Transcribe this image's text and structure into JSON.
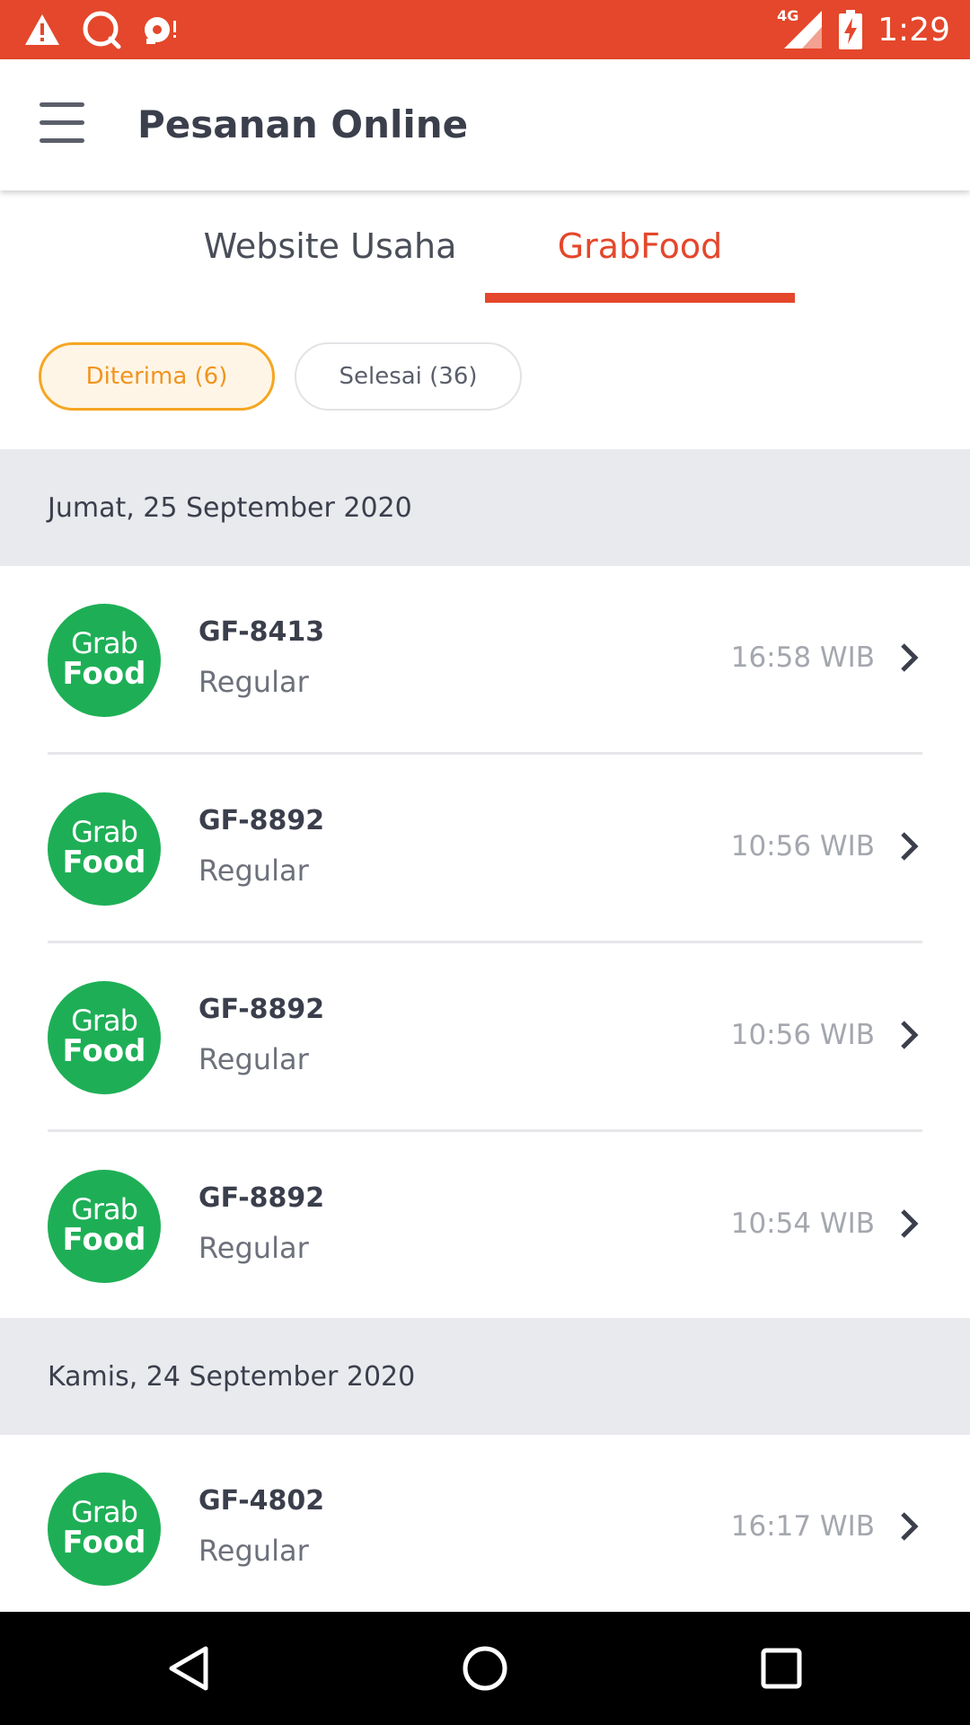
{
  "status_bar": {
    "time": "1:29",
    "network": "4G",
    "icons": [
      "warning-icon",
      "chat-bubble-icon",
      "notification-badge-icon",
      "signal-icon",
      "battery-charging-icon"
    ]
  },
  "app_bar": {
    "title": "Pesanan Online",
    "menu_icon": "hamburger-menu-icon"
  },
  "tabs": [
    {
      "label": "Website Usaha",
      "active": false
    },
    {
      "label": "GrabFood",
      "active": true
    }
  ],
  "filters": [
    {
      "label": "Diterima (6)",
      "active": true
    },
    {
      "label": "Selesai (36)",
      "active": false
    }
  ],
  "groups": [
    {
      "date": "Jumat, 25 September 2020",
      "orders": [
        {
          "id": "GF-8413",
          "type": "Regular",
          "time": "16:58 WIB"
        },
        {
          "id": "GF-8892",
          "type": "Regular",
          "time": "10:56 WIB"
        },
        {
          "id": "GF-8892",
          "type": "Regular",
          "time": "10:56 WIB"
        },
        {
          "id": "GF-8892",
          "type": "Regular",
          "time": "10:54 WIB"
        }
      ]
    },
    {
      "date": "Kamis, 24 September 2020",
      "orders": [
        {
          "id": "GF-4802",
          "type": "Regular",
          "time": "16:17 WIB"
        }
      ]
    }
  ],
  "logo": {
    "line1": "Grab",
    "line2": "Food"
  },
  "colors": {
    "accent": "#e4472b",
    "chip_active": "#f5a623",
    "grabfood_green": "#1eaf56",
    "section_bg": "#e9eaee"
  },
  "nav_bar": {
    "icons": [
      "back-triangle-icon",
      "home-circle-icon",
      "recents-square-icon"
    ]
  }
}
